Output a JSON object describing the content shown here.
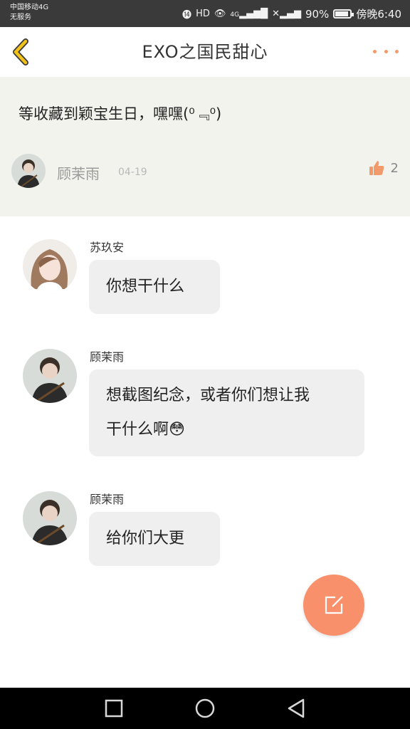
{
  "status_bar": {
    "carrier_line1": "中国移动4G",
    "carrier_line2": "无服务",
    "network": "4G",
    "battery": "90%",
    "battery_level": 0.9,
    "time": "傍晚6:40"
  },
  "header": {
    "title": "EXO之国民甜心"
  },
  "post": {
    "text": "等收藏到颖宝生日，嘿嘿(⁰﹃⁰)",
    "author": "顾茉雨",
    "date": "04-19",
    "likes": "2"
  },
  "messages": [
    {
      "name": "苏玖安",
      "lines": [
        "你想干什么"
      ]
    },
    {
      "name": "顾茉雨",
      "lines": [
        "想截图纪念，或者你们想让我",
        "干什么啊😳"
      ]
    },
    {
      "name": "顾茉雨",
      "lines": [
        "给你们大更"
      ]
    }
  ],
  "colors": {
    "accent": "#f8906b",
    "back_arrow": "#f3c21a",
    "like": "#f39a6a"
  }
}
